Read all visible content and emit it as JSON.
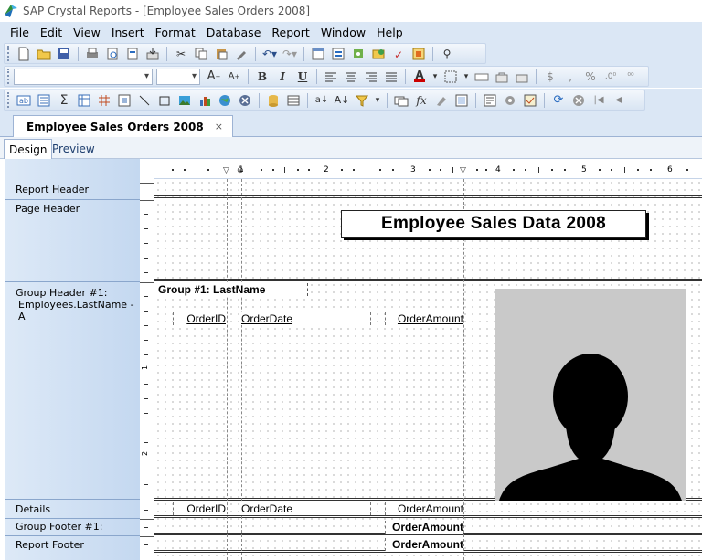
{
  "window": {
    "title": "SAP Crystal Reports - [Employee Sales Orders 2008]"
  },
  "menu": [
    {
      "name": "file",
      "label": "File"
    },
    {
      "name": "edit",
      "label": "Edit"
    },
    {
      "name": "view",
      "label": "View"
    },
    {
      "name": "insert",
      "label": "Insert"
    },
    {
      "name": "format",
      "label": "Format"
    },
    {
      "name": "database",
      "label": "Database"
    },
    {
      "name": "report",
      "label": "Report"
    },
    {
      "name": "window",
      "label": "Window"
    },
    {
      "name": "help",
      "label": "Help"
    }
  ],
  "toolbar": {
    "font_name": "",
    "font_size": "",
    "fmt": {
      "grow": "A",
      "shrink": "A",
      "bold": "B",
      "italic": "I",
      "underline": "U",
      "font_color": "A",
      "currency": "$",
      "comma": ",",
      "percent": "%"
    },
    "misc": {
      "sigma": "Σ",
      "fx": "fx",
      "align_tab": "ab"
    }
  },
  "doc_tab": {
    "label": "Employee Sales Orders 2008",
    "close": "×"
  },
  "view_tabs": {
    "design": "Design",
    "preview": "Preview"
  },
  "sections": {
    "report_header": "Report Header",
    "page_header": "Page Header",
    "group_header": "Group Header #1:",
    "group_header_sub": "Employees.LastName - A",
    "details": "Details",
    "group_footer": "Group Footer #1:",
    "report_footer": "Report Footer"
  },
  "ruler": {
    "h": [
      "1",
      "2",
      "3",
      "4",
      "5",
      "6"
    ],
    "v": [
      "1",
      "2"
    ]
  },
  "report": {
    "title": "Employee Sales Data 2008",
    "group_name": "Group #1: LastName",
    "col_headers": {
      "order_id": "OrderID",
      "order_date": "OrderDate",
      "order_amount": "OrderAmount"
    },
    "details": {
      "order_id": "OrderID",
      "order_date": "OrderDate",
      "order_amount": "OrderAmount"
    },
    "group_footer_total": "OrderAmount",
    "report_footer_total": "OrderAmount"
  },
  "icons": [
    "new-icon",
    "open-icon",
    "save-icon",
    "print-icon",
    "preview-icon",
    "export-icon",
    "cut-icon",
    "copy-icon",
    "paste-icon",
    "undo-icon",
    "redo-icon",
    "field-explorer-icon",
    "find-icon",
    "photo-placeholder-icon"
  ]
}
